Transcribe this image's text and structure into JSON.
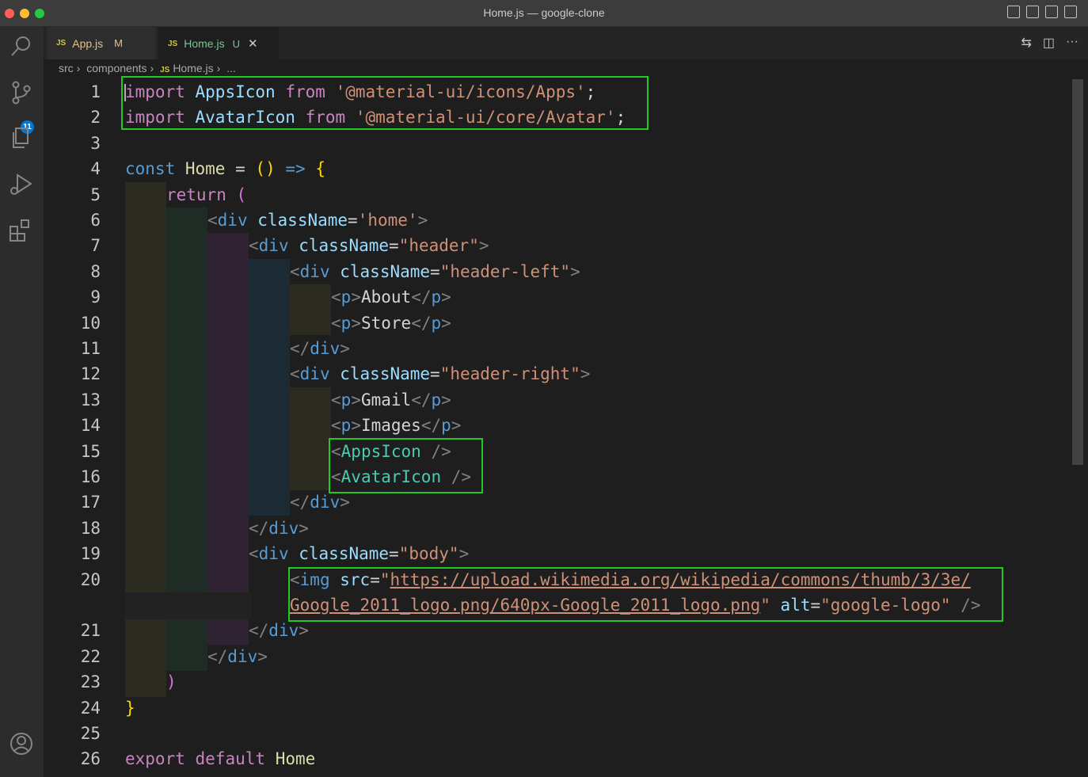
{
  "window": {
    "title": "Home.js — google-clone"
  },
  "activity": {
    "scm_badge": "11"
  },
  "tabs": [
    {
      "icon": "JS",
      "name": "App.js",
      "status": "M"
    },
    {
      "icon": "JS",
      "name": "Home.js",
      "status": "U"
    }
  ],
  "breadcrumb": [
    "src",
    "components",
    "Home.js",
    "..."
  ],
  "line_numbers": [
    "1",
    "2",
    "3",
    "4",
    "5",
    "6",
    "7",
    "8",
    "9",
    "10",
    "11",
    "12",
    "13",
    "14",
    "15",
    "16",
    "17",
    "18",
    "19",
    "20",
    "21",
    "22",
    "23",
    "24",
    "25",
    "26"
  ],
  "code": {
    "l1": [
      "import",
      "AppsIcon",
      "from",
      "'@material-ui/icons/Apps'",
      ";"
    ],
    "l2": [
      "import",
      "AvatarIcon",
      "from",
      "'@material-ui/core/Avatar'",
      ";"
    ],
    "l4": [
      "const",
      "Home",
      "=",
      "()",
      "=>",
      "{"
    ],
    "l5": [
      "return",
      "("
    ],
    "l6": [
      "<",
      "div",
      "className",
      "=",
      "'home'",
      ">"
    ],
    "l7": [
      "<",
      "div",
      "className",
      "=",
      "\"header\"",
      ">"
    ],
    "l8": [
      "<",
      "div",
      "className",
      "=",
      "\"header-left\"",
      ">"
    ],
    "l9": [
      "<",
      "p",
      ">",
      "About",
      "</",
      "p",
      ">"
    ],
    "l10": [
      "<",
      "p",
      ">",
      "Store",
      "</",
      "p",
      ">"
    ],
    "l11": [
      "</",
      "div",
      ">"
    ],
    "l12": [
      "<",
      "div",
      "className",
      "=",
      "\"header-right\"",
      ">"
    ],
    "l13": [
      "<",
      "p",
      ">",
      "Gmail",
      "</",
      "p",
      ">"
    ],
    "l14": [
      "<",
      "p",
      ">",
      "Images",
      "</",
      "p",
      ">"
    ],
    "l15": [
      "<",
      "AppsIcon",
      "/>"
    ],
    "l16": [
      "<",
      "AvatarIcon",
      "/>"
    ],
    "l17": [
      "</",
      "div",
      ">"
    ],
    "l18": [
      "</",
      "div",
      ">"
    ],
    "l19": [
      "<",
      "div",
      "className",
      "=",
      "\"body\"",
      ">"
    ],
    "l20": [
      "<",
      "img",
      "src",
      "=",
      "\"",
      "https://upload.wikimedia.org/wikipedia/commons/thumb/3/3e/"
    ],
    "l20b": [
      "Google_2011_logo.png/640px-Google_2011_logo.png",
      "\"",
      "alt",
      "=",
      "\"google-logo\"",
      "/>"
    ],
    "l21": [
      "</",
      "div",
      ">"
    ],
    "l22": [
      "</",
      "div",
      ">"
    ],
    "l23": [
      ")"
    ],
    "l24": [
      "}"
    ],
    "l26": [
      "export",
      "default",
      "Home"
    ]
  },
  "colors": {
    "highlight_box": "#22c922",
    "accent": "#0078d4"
  }
}
